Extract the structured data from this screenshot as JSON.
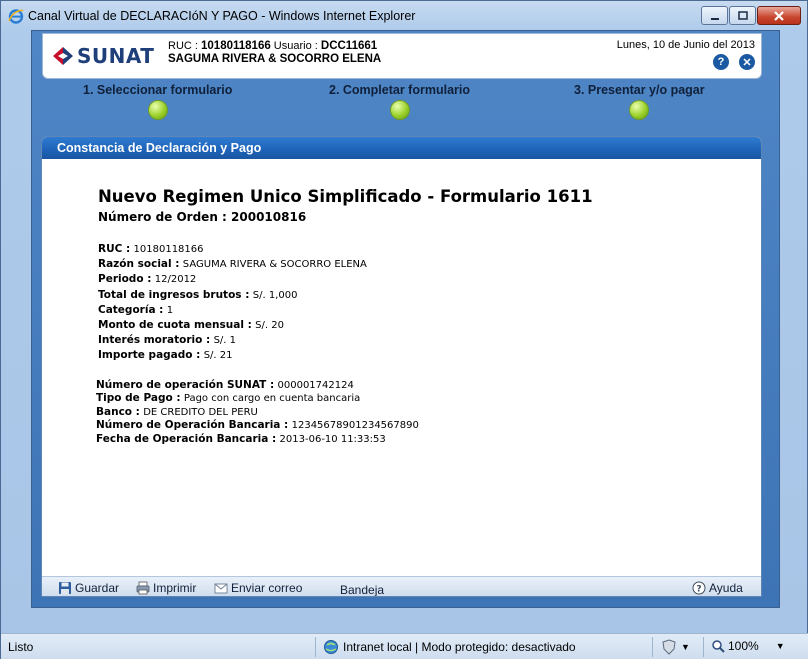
{
  "window": {
    "title": "Canal Virtual de DECLARACIóN Y PAGO - Windows Internet Explorer"
  },
  "header": {
    "logo_text": "SUNAT",
    "ruc_label": "RUC :",
    "ruc_value": "10180118166",
    "user_label": "Usuario :",
    "user_value": "DCC11661",
    "company": "SAGUMA RIVERA & SOCORRO ELENA",
    "date": "Lunes, 10 de Junio del 2013"
  },
  "steps": [
    {
      "label": "1. Seleccionar formulario"
    },
    {
      "label": "2. Completar formulario"
    },
    {
      "label": "3. Presentar y/o pagar"
    }
  ],
  "panel": {
    "title": "Constancia de Declaración y Pago",
    "doc_title": "Nuevo Regimen Unico Simplificado - Formulario 1611",
    "order_label": "Número de Orden :",
    "order_value": "200010816"
  },
  "fields": [
    {
      "label": "RUC :",
      "value": "10180118166"
    },
    {
      "label": "Razón social :",
      "value": "SAGUMA RIVERA & SOCORRO ELENA"
    },
    {
      "label": "Periodo :",
      "value": "12/2012"
    },
    {
      "label": "Total de ingresos brutos :",
      "value": "S/. 1,000"
    },
    {
      "label": "Categoría :",
      "value": "1"
    },
    {
      "label": "Monto de cuota mensual :",
      "value": "S/. 20"
    },
    {
      "label": "Interés moratorio :",
      "value": "S/. 1"
    },
    {
      "label": "Importe pagado :",
      "value": "S/. 21"
    }
  ],
  "payment_fields": [
    {
      "label": "Número de operación SUNAT :",
      "value": "000001742124"
    },
    {
      "label": "Tipo de Pago :",
      "value": "Pago con cargo en cuenta bancaria"
    },
    {
      "label": "Banco :",
      "value": "DE CREDITO DEL PERU"
    },
    {
      "label": "Número de Operación Bancaria :",
      "value": "12345678901234567890"
    },
    {
      "label": "Fecha de Operación Bancaria :",
      "value": "2013-06-10 11:33:53"
    }
  ],
  "footer": {
    "save": "Guardar",
    "print": "Imprimir",
    "email": "Enviar correo",
    "tray": "Bandeja",
    "help": "Ayuda"
  },
  "statusbar": {
    "status": "Listo",
    "zone": "Intranet local | Modo protegido: desactivado",
    "zoom": "100%"
  }
}
